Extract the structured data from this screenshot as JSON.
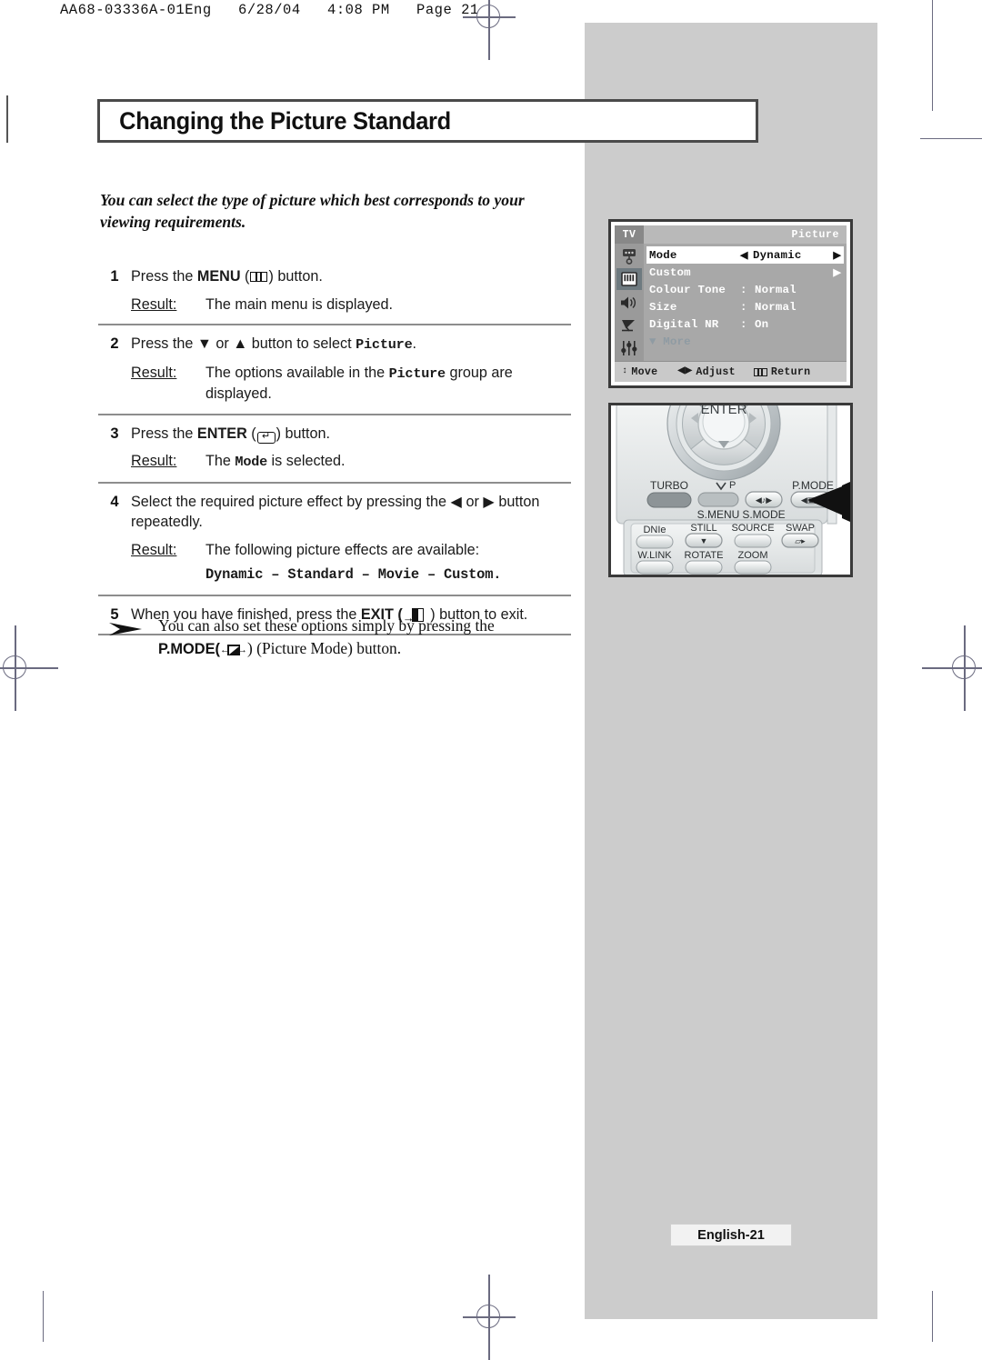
{
  "print_header": "AA68-03336A-01Eng   6/28/04   4:08 PM   Page 21",
  "title": "Changing the Picture Standard",
  "intro": "You can select the type of picture which best corresponds to your viewing requirements.",
  "result_label": "Result:",
  "steps": [
    {
      "num": "1",
      "text_before": "Press the ",
      "bold": "MENU",
      "icon": "menu-icon",
      "text_after": ") button.",
      "result": "The main menu is displayed."
    },
    {
      "num": "2",
      "text": "Press the ▼ or ▲ button to select ",
      "mono": "Picture",
      "text_end": ".",
      "result_a": "The options available in the ",
      "result_mono": "Picture",
      "result_b": " group are displayed."
    },
    {
      "num": "3",
      "text_before": "Press the ",
      "bold": "ENTER",
      "icon": "enter-icon",
      "text_after": ") button.",
      "result_a": "The ",
      "result_mono": "Mode",
      "result_b": " is selected."
    },
    {
      "num": "4",
      "text": "Select the required picture effect by pressing the ◀ or ▶ button repeatedly.",
      "result": "The following picture effects are available:",
      "effects": "Dynamic – Standard – Movie – Custom."
    },
    {
      "num": "5",
      "text_before": "When you have finished, press the ",
      "bold": "EXIT",
      "icon": "exit-icon",
      "text_after": " ) button to exit."
    }
  ],
  "note": {
    "arrow_icon": "arrowhead-bullet-icon",
    "line1": "You can also set these options simply by pressing the",
    "bold": "P.MODE",
    "icon": "pmode-icon",
    "line2_tail": ") (Picture Mode) button."
  },
  "osd": {
    "source_label": "TV",
    "title": "Picture",
    "rail_icons": [
      "input-source-icon",
      "picture-icon",
      "sound-speaker-icon",
      "satellite-dish-icon",
      "setup-sliders-icon"
    ],
    "rail_active_index": 1,
    "rows": [
      {
        "key": "Mode",
        "sep": "",
        "value": "Dynamic",
        "selected": true,
        "left_arrow": "◀",
        "right_arrow": "▶"
      },
      {
        "key": "Custom",
        "sep": "",
        "value": "",
        "selected": false,
        "left_arrow": "",
        "right_arrow": "▶"
      },
      {
        "key": "Colour Tone",
        "sep": ":",
        "value": "Normal",
        "selected": false,
        "left_arrow": "",
        "right_arrow": ""
      },
      {
        "key": "Size",
        "sep": ":",
        "value": "Normal",
        "selected": false,
        "left_arrow": "",
        "right_arrow": ""
      },
      {
        "key": "Digital NR",
        "sep": ":",
        "value": "On",
        "selected": false,
        "left_arrow": "",
        "right_arrow": ""
      },
      {
        "key": "▼ More",
        "sep": "",
        "value": "",
        "selected": false,
        "more": true,
        "left_arrow": "",
        "right_arrow": ""
      }
    ],
    "footer": [
      {
        "icon": "up-down-arrows-icon",
        "glyph": "↕",
        "label": "Move"
      },
      {
        "icon": "left-right-arrows-icon",
        "glyph": "◀▶",
        "label": "Adjust"
      },
      {
        "icon": "menu-icon",
        "glyph": "",
        "label": "Return"
      }
    ]
  },
  "remote": {
    "enter_label": "ENTER",
    "buttons_row1": [
      {
        "label": "TURBO",
        "name": "turbo-button"
      },
      {
        "label": "S.MENU",
        "name": "s-menu-button"
      },
      {
        "label": "S.MODE",
        "name": "s-mode-button"
      },
      {
        "label": "P.MODE",
        "name": "p-mode-button"
      }
    ],
    "p_label": "P",
    "buttons_row2": [
      {
        "label": "DNIe",
        "name": "dnie-button"
      },
      {
        "label": "STILL",
        "name": "still-button"
      },
      {
        "label": "SOURCE",
        "name": "source-button"
      },
      {
        "label": "SWAP",
        "name": "swap-button"
      }
    ],
    "buttons_row3": [
      {
        "label": "W.LINK",
        "name": "w-link-button"
      },
      {
        "label": "ROTATE",
        "name": "rotate-button"
      },
      {
        "label": "ZOOM",
        "name": "zoom-button"
      }
    ],
    "pointer_icon": "pointing-hand-arrow-icon"
  },
  "page_badge": "English-21",
  "colors": {
    "panel_grey": "#cccccc",
    "osd_body": "#a8a8a8",
    "osd_rail": "#9a9a9a",
    "osd_active": "#6e7a80",
    "rule": "#8d8d8d"
  }
}
